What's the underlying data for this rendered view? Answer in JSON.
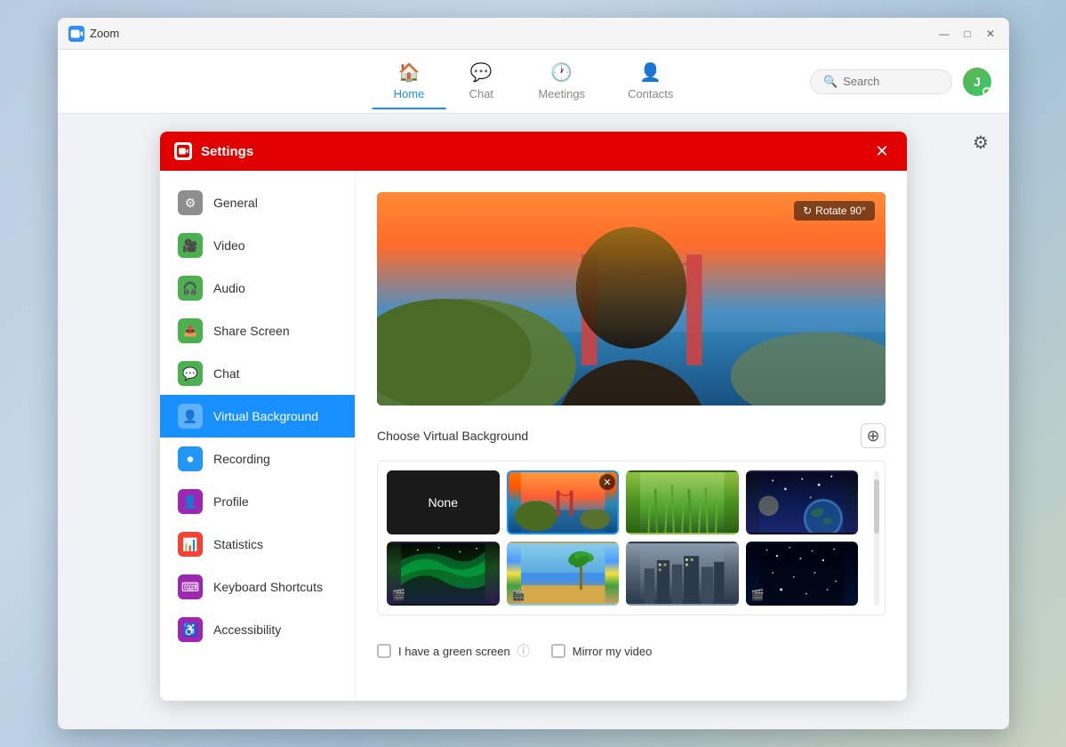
{
  "app": {
    "title": "Zoom",
    "window_controls": {
      "minimize": "—",
      "maximize": "□",
      "close": "✕"
    }
  },
  "nav": {
    "tabs": [
      {
        "id": "home",
        "label": "Home",
        "icon": "🏠",
        "active": true
      },
      {
        "id": "chat",
        "label": "Chat",
        "icon": "💬",
        "active": false
      },
      {
        "id": "meetings",
        "label": "Meetings",
        "icon": "🕐",
        "active": false
      },
      {
        "id": "contacts",
        "label": "Contacts",
        "icon": "👤",
        "active": false
      }
    ],
    "search": {
      "placeholder": "Search"
    }
  },
  "settings": {
    "title": "Settings",
    "close_btn": "✕",
    "active_section": "Virtual Background",
    "sidebar_items": [
      {
        "id": "general",
        "label": "General",
        "icon": "⚙"
      },
      {
        "id": "video",
        "label": "Video",
        "icon": "📹"
      },
      {
        "id": "audio",
        "label": "Audio",
        "icon": "🎧"
      },
      {
        "id": "share-screen",
        "label": "Share Screen",
        "icon": "📱"
      },
      {
        "id": "chat",
        "label": "Chat",
        "icon": "💬"
      },
      {
        "id": "virtual-background",
        "label": "Virtual Background",
        "icon": "👤",
        "active": true
      },
      {
        "id": "recording",
        "label": "Recording",
        "icon": "⏺"
      },
      {
        "id": "profile",
        "label": "Profile",
        "icon": "👤"
      },
      {
        "id": "statistics",
        "label": "Statistics",
        "icon": "📊"
      },
      {
        "id": "keyboard-shortcuts",
        "label": "Keyboard Shortcuts",
        "icon": "⌨"
      },
      {
        "id": "accessibility",
        "label": "Accessibility",
        "icon": "♿"
      }
    ],
    "content": {
      "rotate_btn": "↻ Rotate 90°",
      "section_title": "Choose Virtual Background",
      "add_btn": "⊕",
      "vbg_items": [
        {
          "id": "none",
          "label": "None",
          "type": "none"
        },
        {
          "id": "bridge",
          "label": "Golden Gate Bridge",
          "type": "image",
          "selected": true
        },
        {
          "id": "grass",
          "label": "Grass Field",
          "type": "image"
        },
        {
          "id": "space",
          "label": "Space",
          "type": "image"
        },
        {
          "id": "aurora",
          "label": "Aurora",
          "type": "video"
        },
        {
          "id": "beach",
          "label": "Beach",
          "type": "video"
        },
        {
          "id": "city",
          "label": "City",
          "type": "image"
        },
        {
          "id": "stars",
          "label": "Stars",
          "type": "video"
        }
      ],
      "checkboxes": [
        {
          "id": "green-screen",
          "label": "I have a green screen",
          "checked": false,
          "has_info": true
        },
        {
          "id": "mirror-video",
          "label": "Mirror my video",
          "checked": false,
          "has_info": false
        }
      ]
    }
  }
}
